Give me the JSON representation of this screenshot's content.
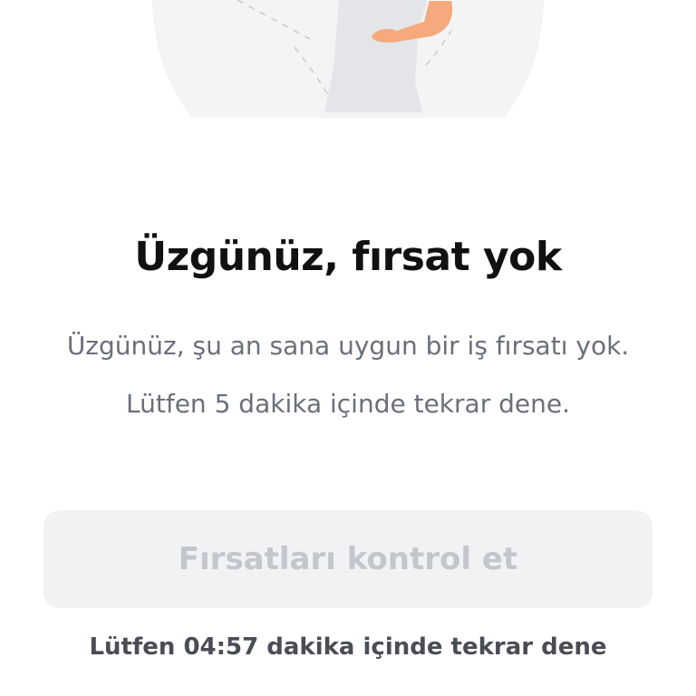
{
  "empty_state": {
    "title": "Üzgünüz, fırsat yok",
    "message": "Üzgünüz, şu an sana uygun bir iş fırsatı yok. Lütfen 5 dakika içinde tekrar dene.",
    "illustration_icon": "person-shrug-illustration"
  },
  "actions": {
    "check_opportunities_label": "Fırsatları kontrol et",
    "check_opportunities_enabled": false
  },
  "countdown": {
    "text": "Lütfen 04:57 dakika içinde tekrar dene",
    "remaining": "04:57"
  },
  "colors": {
    "title": "#111111",
    "message": "#6b6f7a",
    "button_bg_disabled": "#f1f2f4",
    "button_text_disabled": "#c3c6cc",
    "countdown": "#4a4d55",
    "illustration_bg": "#f4f4f5",
    "skin": "#f5a97c"
  }
}
